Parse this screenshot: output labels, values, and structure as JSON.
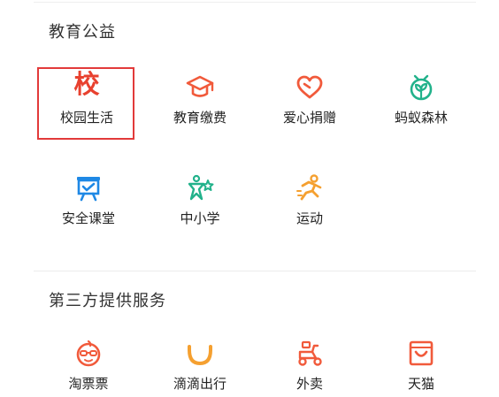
{
  "sections": [
    {
      "title": "教育公益",
      "items": [
        {
          "label": "校园生活",
          "icon": "school-icon",
          "glyph": "校",
          "color": "#e8412f"
        },
        {
          "label": "教育缴费",
          "icon": "graduation-cap-icon",
          "color": "#f15a3b"
        },
        {
          "label": "爱心捐赠",
          "icon": "heart-icon",
          "color": "#f15a3b"
        },
        {
          "label": "蚂蚁森林",
          "icon": "sprout-icon",
          "color": "#22b28b"
        },
        {
          "label": "安全课堂",
          "icon": "presentation-board-icon",
          "color": "#1e88e5"
        },
        {
          "label": "中小学",
          "icon": "children-star-icon",
          "color": "#22b28b"
        },
        {
          "label": "运动",
          "icon": "running-icon",
          "color": "#f5a030"
        }
      ]
    },
    {
      "title": "第三方提供服务",
      "items": [
        {
          "label": "淘票票",
          "icon": "mascot-glasses-icon",
          "color": "#f15a3b"
        },
        {
          "label": "滴滴出行",
          "icon": "didi-logo-icon",
          "color": "#f5a030"
        },
        {
          "label": "外卖",
          "icon": "scooter-icon",
          "color": "#f15a3b"
        },
        {
          "label": "天猫",
          "icon": "tmall-bag-icon",
          "color": "#f15a3b"
        }
      ]
    }
  ]
}
